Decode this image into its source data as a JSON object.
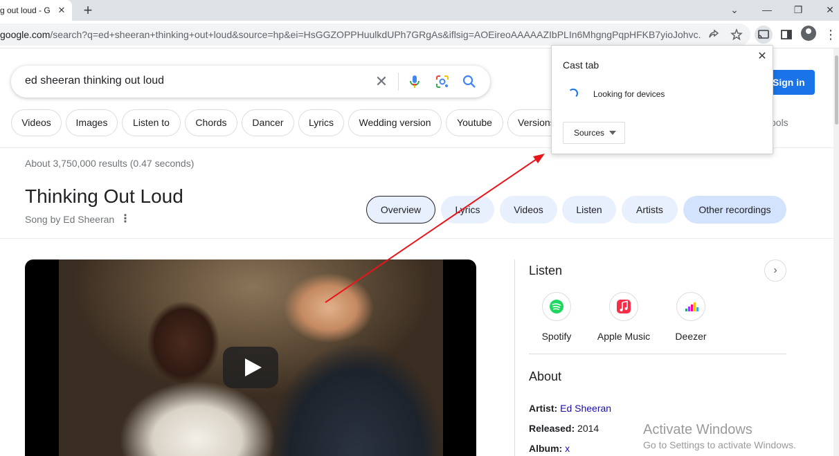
{
  "browser": {
    "tab_title": "g out loud - G",
    "tab_close": "✕",
    "new_tab": "+",
    "window_minimize": "⌄",
    "window_min": "—",
    "window_restore": "❐",
    "window_close": "✕",
    "url_host": "google.com",
    "url_rest": "/search?q=ed+sheeran+thinking+out+loud&source=hp&ei=HsGGZOPPHuulkdUPh7GRgAs&iflsig=AOEireoAAAAAZIbPLIn6MhgngPqpHFKB7yioJohvc...",
    "menu": "⋮"
  },
  "search": {
    "query": "ed sheeran thinking out loud",
    "clear": "✕",
    "sign_in": "Sign in"
  },
  "chips": [
    "Videos",
    "Images",
    "Listen to",
    "Chords",
    "Dancer",
    "Lyrics",
    "Wedding version",
    "Youtube",
    "Versions"
  ],
  "tools_label": "ools",
  "results_stats": "About 3,750,000 results (0.47 seconds)",
  "knowledge_panel": {
    "title": "Thinking Out Loud",
    "subtitle": "Song by Ed Sheeran",
    "more": "⋮",
    "tabs": [
      "Overview",
      "Lyrics",
      "Videos",
      "Listen",
      "Artists",
      "Other recordings"
    ]
  },
  "listen": {
    "heading": "Listen",
    "next": "›",
    "services": [
      "Spotify",
      "Apple Music",
      "Deezer"
    ]
  },
  "about": {
    "heading": "About",
    "artist_label": "Artist:",
    "artist_value": "Ed Sheeran",
    "released_label": "Released:",
    "released_value": "2014",
    "album_label": "Album:",
    "album_value": "x"
  },
  "cast_popup": {
    "title": "Cast tab",
    "close": "✕",
    "status": "Looking for devices",
    "sources": "Sources"
  },
  "watermark": {
    "line1": "Activate Windows",
    "line2": "Go to Settings to activate Windows."
  },
  "colors": {
    "accent": "#1a73e8",
    "link": "#1a0dab",
    "annotation_arrow": "#e8151b"
  }
}
